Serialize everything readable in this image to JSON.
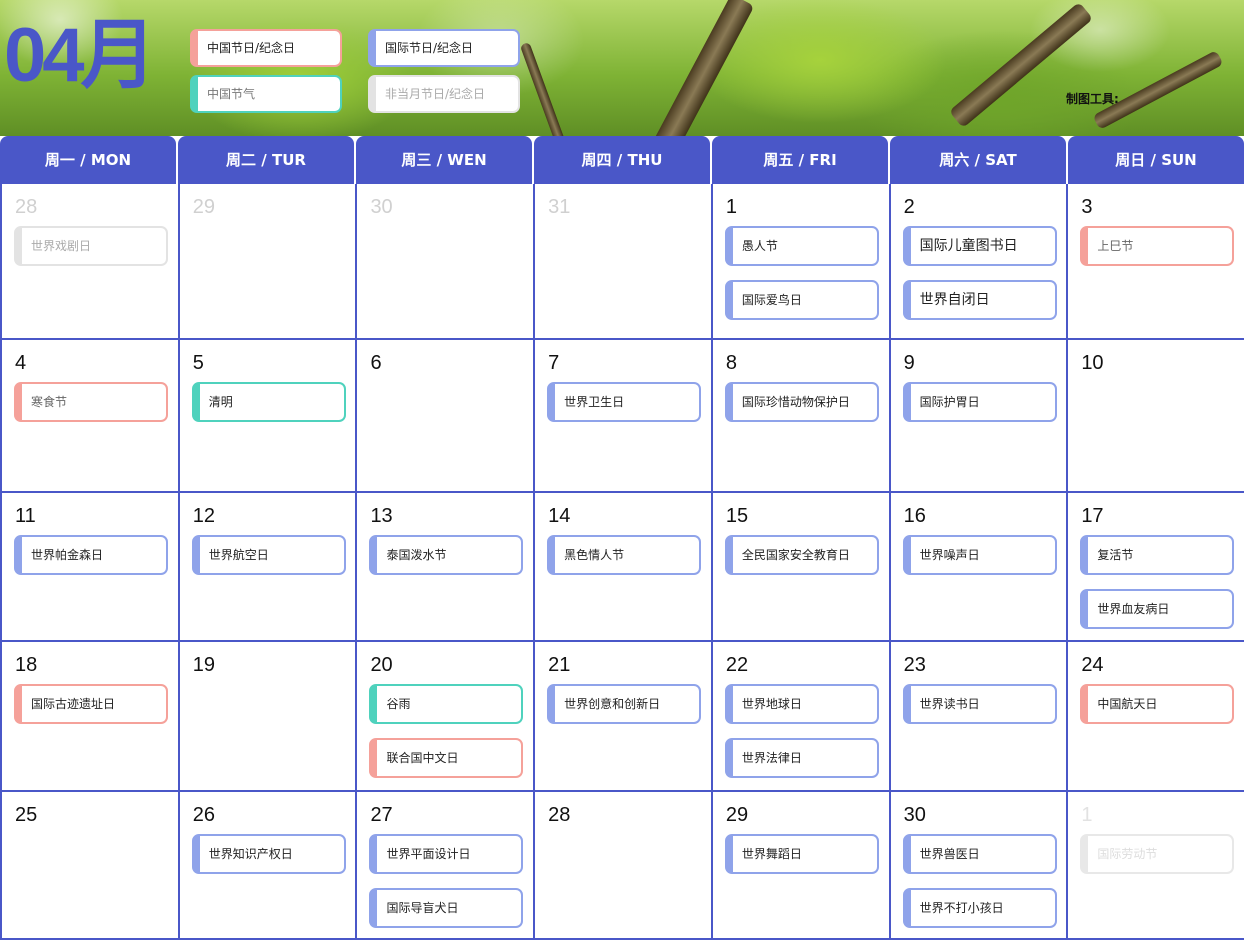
{
  "header": {
    "month": "04月",
    "tool_label": "制图工具:",
    "legend": {
      "cn_festival": "中国节日/纪念日",
      "intl_festival": "国际节日/纪念日",
      "solar_term": "中国节气",
      "other_month": "非当月节日/纪念日"
    }
  },
  "weekdays": [
    "周一 / MON",
    "周二 / TUR",
    "周三 / WEN",
    "周四 / THU",
    "周五 / FRI",
    "周六 / SAT",
    "周日 / SUN"
  ],
  "colors": {
    "accent": "#4a57c8",
    "intl": "#8fa3ea",
    "cn": "#f5a19a",
    "term": "#4fd2bd",
    "other": "#e3e3e3"
  },
  "weeks": [
    [
      {
        "date": "28",
        "other": true,
        "events": [
          {
            "label": "世界戏剧日",
            "type": "other"
          }
        ]
      },
      {
        "date": "29",
        "other": true,
        "events": []
      },
      {
        "date": "30",
        "other": true,
        "events": []
      },
      {
        "date": "31",
        "other": true,
        "events": []
      },
      {
        "date": "1",
        "events": [
          {
            "label": "愚人节",
            "type": "intl"
          },
          {
            "label": "国际爱鸟日",
            "type": "intl"
          }
        ]
      },
      {
        "date": "2",
        "events": [
          {
            "label": "国际儿童图书日",
            "type": "intl",
            "big": true
          },
          {
            "label": "世界自闭日",
            "type": "intl",
            "big": true
          }
        ]
      },
      {
        "date": "3",
        "events": [
          {
            "label": "上巳节",
            "type": "cn"
          }
        ]
      }
    ],
    [
      {
        "date": "4",
        "events": [
          {
            "label": "寒食节",
            "type": "cn"
          }
        ]
      },
      {
        "date": "5",
        "events": [
          {
            "label": "清明",
            "type": "term"
          }
        ]
      },
      {
        "date": "6",
        "events": []
      },
      {
        "date": "7",
        "events": [
          {
            "label": "世界卫生日",
            "type": "intl"
          }
        ]
      },
      {
        "date": "8",
        "events": [
          {
            "label": "国际珍惜动物保护日",
            "type": "intl"
          }
        ]
      },
      {
        "date": "9",
        "events": [
          {
            "label": "国际护胃日",
            "type": "intl"
          }
        ]
      },
      {
        "date": "10",
        "events": []
      }
    ],
    [
      {
        "date": "11",
        "events": [
          {
            "label": "世界帕金森日",
            "type": "intl"
          }
        ]
      },
      {
        "date": "12",
        "events": [
          {
            "label": "世界航空日",
            "type": "intl"
          }
        ]
      },
      {
        "date": "13",
        "events": [
          {
            "label": "泰国泼水节",
            "type": "intl"
          }
        ]
      },
      {
        "date": "14",
        "events": [
          {
            "label": "黑色情人节",
            "type": "intl"
          }
        ]
      },
      {
        "date": "15",
        "events": [
          {
            "label": "全民国家安全教育日",
            "type": "intl"
          }
        ]
      },
      {
        "date": "16",
        "events": [
          {
            "label": "世界噪声日",
            "type": "intl"
          }
        ]
      },
      {
        "date": "17",
        "events": [
          {
            "label": "复活节",
            "type": "intl"
          },
          {
            "label": "世界血友病日",
            "type": "intl"
          }
        ]
      }
    ],
    [
      {
        "date": "18",
        "events": [
          {
            "label": "国际古迹遗址日",
            "type": "cn",
            "dark": true
          }
        ]
      },
      {
        "date": "19",
        "events": []
      },
      {
        "date": "20",
        "events": [
          {
            "label": "谷雨",
            "type": "term"
          },
          {
            "label": "联合国中文日",
            "type": "cn",
            "dark": true
          }
        ]
      },
      {
        "date": "21",
        "events": [
          {
            "label": "世界创意和创新日",
            "type": "intl"
          }
        ]
      },
      {
        "date": "22",
        "events": [
          {
            "label": "世界地球日",
            "type": "intl"
          },
          {
            "label": "世界法律日",
            "type": "intl"
          }
        ]
      },
      {
        "date": "23",
        "events": [
          {
            "label": "世界读书日",
            "type": "intl"
          }
        ]
      },
      {
        "date": "24",
        "events": [
          {
            "label": "中国航天日",
            "type": "cn",
            "dark": true
          }
        ]
      }
    ],
    [
      {
        "date": "25",
        "events": []
      },
      {
        "date": "26",
        "events": [
          {
            "label": "世界知识产权日",
            "type": "intl"
          }
        ]
      },
      {
        "date": "27",
        "events": [
          {
            "label": "世界平面设计日",
            "type": "intl"
          },
          {
            "label": "国际导盲犬日",
            "type": "intl"
          }
        ]
      },
      {
        "date": "28",
        "events": []
      },
      {
        "date": "29",
        "events": [
          {
            "label": "世界舞蹈日",
            "type": "intl"
          }
        ]
      },
      {
        "date": "30",
        "events": [
          {
            "label": "世界兽医日",
            "type": "intl"
          },
          {
            "label": "世界不打小孩日",
            "type": "intl"
          }
        ]
      },
      {
        "date": "1",
        "other": true,
        "faint": true,
        "events": [
          {
            "label": "国际劳动节",
            "type": "faint"
          }
        ]
      }
    ]
  ]
}
